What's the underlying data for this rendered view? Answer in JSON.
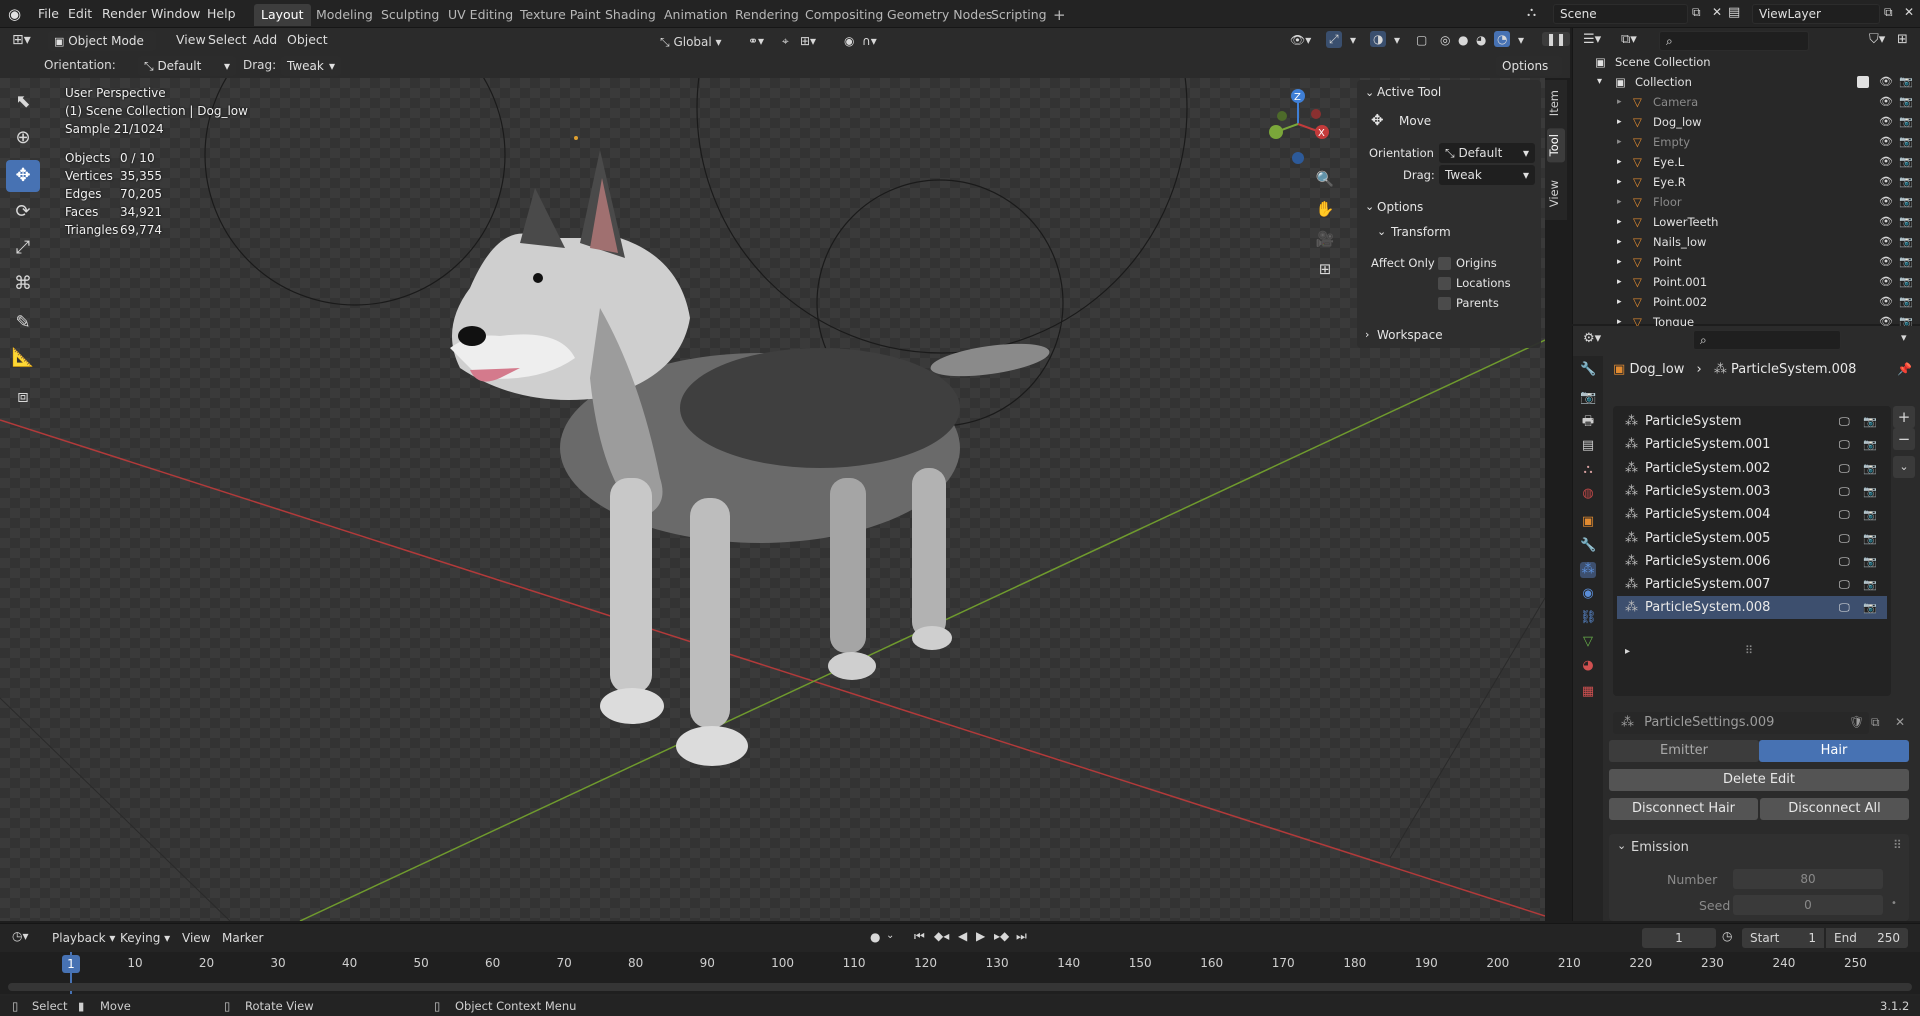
{
  "menu": [
    "File",
    "Edit",
    "Render",
    "Window",
    "Help"
  ],
  "workspaces": [
    "Layout",
    "Modeling",
    "Sculpting",
    "UV Editing",
    "Texture Paint",
    "Shading",
    "Animation",
    "Rendering",
    "Compositing",
    "Geometry Nodes",
    "Scripting"
  ],
  "scene": "Scene",
  "view_layer": "ViewLayer",
  "viewport_header": {
    "mode": "Object Mode",
    "menus": [
      "View",
      "Select",
      "Add",
      "Object"
    ],
    "transform_orientation": "Global",
    "options": "Options"
  },
  "tool_header": {
    "orientation_label": "Orientation:",
    "orientation_value": "Default",
    "drag_label": "Drag:",
    "drag_value": "Tweak"
  },
  "overlay": {
    "perspective": "User Perspective",
    "collection": "(1) Scene Collection | Dog_low",
    "sample": "Sample 21/1024",
    "stats": [
      {
        "label": "Objects",
        "value": "0 / 10"
      },
      {
        "label": "Vertices",
        "value": "35,355"
      },
      {
        "label": "Edges",
        "value": "70,205"
      },
      {
        "label": "Faces",
        "value": "34,921"
      },
      {
        "label": "Triangles",
        "value": "69,774"
      }
    ]
  },
  "npanel": {
    "active_tool": "Active Tool",
    "tool_name": "Move",
    "orientation_label": "Orientation",
    "orientation_value": "Default",
    "drag_label": "Drag:",
    "drag_value": "Tweak",
    "options": "Options",
    "transform": "Transform",
    "affect_only": "Affect Only",
    "origins": "Origins",
    "locations": "Locations",
    "parents": "Parents",
    "workspace": "Workspace",
    "tabs": [
      "Item",
      "Tool",
      "View"
    ]
  },
  "outliner": {
    "root": "Scene Collection",
    "collection": "Collection",
    "items": [
      {
        "name": "Camera",
        "dim": true
      },
      {
        "name": "Dog_low",
        "dim": false
      },
      {
        "name": "Empty",
        "dim": true
      },
      {
        "name": "Eye.L",
        "dim": false
      },
      {
        "name": "Eye.R",
        "dim": false
      },
      {
        "name": "Floor",
        "dim": true
      },
      {
        "name": "LowerTeeth",
        "dim": false
      },
      {
        "name": "Nails_low",
        "dim": false
      },
      {
        "name": "Point",
        "dim": false
      },
      {
        "name": "Point.001",
        "dim": false
      },
      {
        "name": "Point.002",
        "dim": false
      },
      {
        "name": "Tongue",
        "dim": false
      }
    ]
  },
  "properties": {
    "object": "Dog_low",
    "system": "ParticleSystem.008",
    "systems": [
      "ParticleSystem",
      "ParticleSystem.001",
      "ParticleSystem.002",
      "ParticleSystem.003",
      "ParticleSystem.004",
      "ParticleSystem.005",
      "ParticleSystem.006",
      "ParticleSystem.007",
      "ParticleSystem.008"
    ],
    "settings": "ParticleSettings.009",
    "emitter": "Emitter",
    "hair": "Hair",
    "delete_edit": "Delete Edit",
    "disconnect_hair": "Disconnect Hair",
    "disconnect_all": "Disconnect All",
    "emission": "Emission",
    "number_label": "Number",
    "number_value": "80",
    "seed_label": "Seed",
    "seed_value": "0"
  },
  "timeline": {
    "menus": [
      "Playback",
      "Keying",
      "View",
      "Marker"
    ],
    "current_frame": "1",
    "start_label": "Start",
    "start_value": "1",
    "end_label": "End",
    "end_value": "250",
    "ticks": [
      "1",
      "10",
      "20",
      "30",
      "40",
      "50",
      "60",
      "70",
      "80",
      "90",
      "100",
      "110",
      "120",
      "130",
      "140",
      "150",
      "160",
      "170",
      "180",
      "190",
      "200",
      "210",
      "220",
      "230",
      "240",
      "250"
    ]
  },
  "status": {
    "select": "Select",
    "move": "Move",
    "rotate": "Rotate View",
    "context": "Object Context Menu",
    "version": "3.1.2"
  },
  "colors": {
    "accent": "#4772b3",
    "x_axis": "#c33b3b",
    "y_axis": "#7aa63a",
    "z_axis": "#3f7fd6"
  }
}
